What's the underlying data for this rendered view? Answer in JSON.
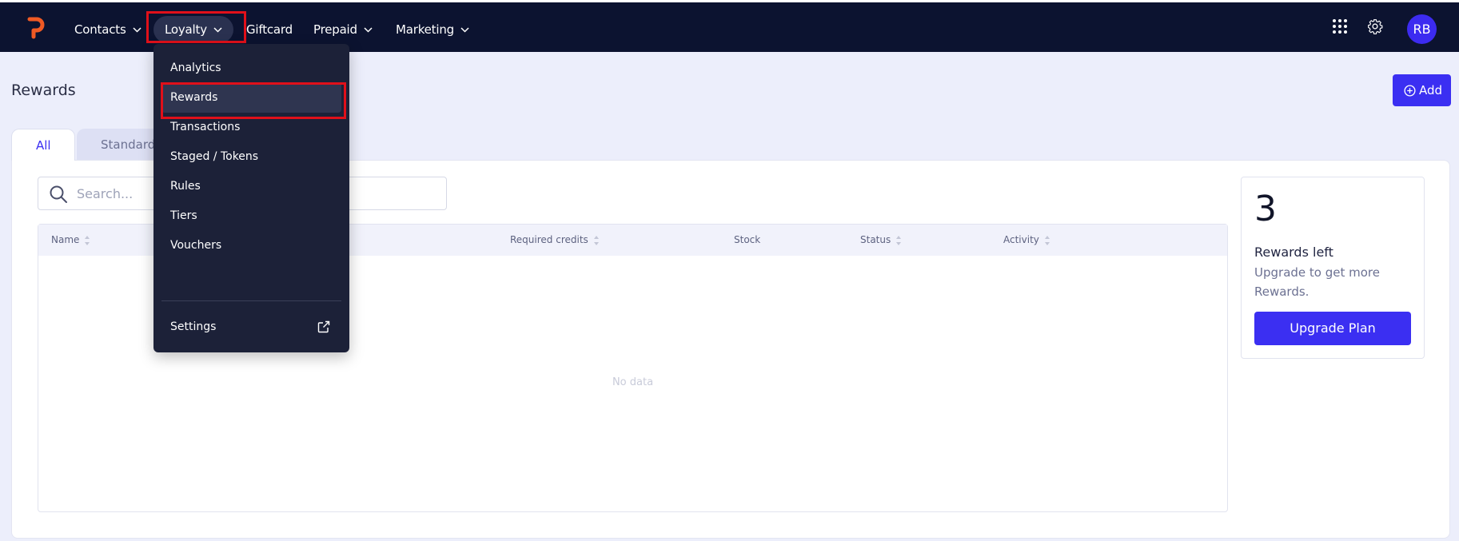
{
  "nav": {
    "items": [
      {
        "label": "Contacts",
        "has_chevron": true
      },
      {
        "label": "Loyalty",
        "has_chevron": true,
        "active": true
      },
      {
        "label": "Giftcard",
        "has_chevron": false
      },
      {
        "label": "Prepaid",
        "has_chevron": true
      },
      {
        "label": "Marketing",
        "has_chevron": true
      }
    ],
    "avatar_initials": "RB",
    "icons": [
      "logo-icon",
      "apps-grid-icon",
      "gear-icon"
    ]
  },
  "loyalty_menu": {
    "items": [
      "Analytics",
      "Rewards",
      "Transactions",
      "Staged / Tokens",
      "Rules",
      "Tiers",
      "Vouchers"
    ],
    "selected": "Rewards",
    "settings_label": "Settings"
  },
  "page": {
    "title": "Rewards",
    "add_label": "Add",
    "tabs": [
      "All",
      "Standard"
    ],
    "active_tab": "All",
    "search_placeholder": "Search...",
    "columns": [
      "Name",
      "Required credits",
      "Stock",
      "Status",
      "Activity"
    ],
    "empty_text": "No data"
  },
  "card": {
    "count": "3",
    "title": "Rewards left",
    "description": "Upgrade to get more Rewards.",
    "button_label": "Upgrade Plan"
  },
  "colors": {
    "nav_bg": "#0c1330",
    "accent": "#3b2ff2",
    "logo": "#f05a24",
    "highlight": "#e0101a",
    "menu_bg": "#1c2138"
  }
}
